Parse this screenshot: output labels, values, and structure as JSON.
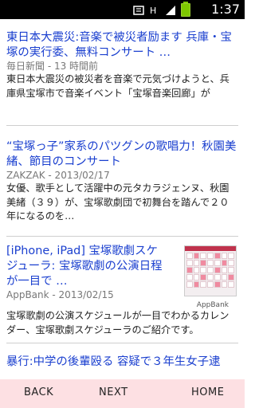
{
  "status_bar": {
    "time": "1:37",
    "icons": [
      "notification-icon",
      "sim-icon",
      "signal-icon",
      "battery-icon"
    ]
  },
  "articles": [
    {
      "title": "東日本大震災:音楽で被災者励ます 兵庫・宝塚の実行委、無料コンサート …",
      "source_time": "毎日新聞 - 13 時間前",
      "body": "東日本大震災の被災者を音楽で元気づけようと、兵庫県宝塚市で音楽イベント「宝塚音楽回廊」が"
    },
    {
      "title": "“宝塚っ子”家系のパツグンの歌唱力！秋園美緒、節目のコンサート",
      "source_time": "ZAKZAK - 2013/02/17",
      "body": "女優、歌手として活躍中の元タカラジェンヌ、秋園美緒（３９）が、宝塚歌劇団で初舞台を踏んで２０年になるのを…"
    },
    {
      "title": "[iPhone, iPad] 宝塚歌劇スケジューラ: 宝塚歌劇の公演日程が一目で …",
      "source_time": "AppBank - 2013/02/15",
      "body": "宝塚歌劇の公演スケジュールが一目でわかるカレンダー、宝塚歌劇スケジューラのご紹介です。",
      "thumb_caption": "AppBank"
    },
    {
      "title": "暴行:中学の後輩殴る 容疑で３年生女子逮"
    }
  ],
  "bottom_nav": {
    "back": "BACK",
    "next": "NEXT",
    "home": "HOME"
  }
}
